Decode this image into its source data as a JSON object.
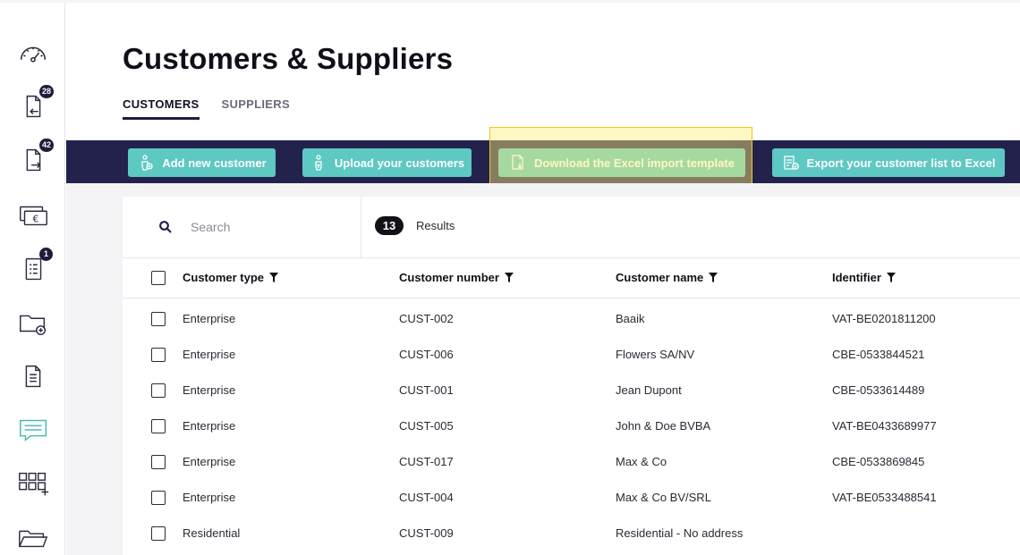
{
  "sidebar": {
    "items": [
      {
        "name": "dashboard",
        "icon": "speedometer-icon",
        "badge": ""
      },
      {
        "name": "incoming-documents",
        "icon": "document-in-icon",
        "badge": "28"
      },
      {
        "name": "outgoing-documents",
        "icon": "document-out-icon",
        "badge": "42"
      },
      {
        "name": "payments",
        "icon": "euro-cards-icon",
        "badge": ""
      },
      {
        "name": "tasks",
        "icon": "checklist-icon",
        "badge": "1"
      },
      {
        "name": "add-folder",
        "icon": "folder-plus-icon",
        "badge": ""
      },
      {
        "name": "reports",
        "icon": "document-lines-icon",
        "badge": ""
      },
      {
        "name": "messages",
        "icon": "message-icon",
        "badge": ""
      },
      {
        "name": "apps",
        "icon": "grid-plus-icon",
        "badge": ""
      },
      {
        "name": "documents",
        "icon": "folder-open-icon",
        "badge": ""
      }
    ]
  },
  "page": {
    "title": "Customers & Suppliers",
    "tabs": [
      {
        "label": "CUSTOMERS",
        "active": true
      },
      {
        "label": "SUPPLIERS",
        "active": false
      }
    ]
  },
  "toolbar": {
    "add_label": "Add new customer",
    "upload_label": "Upload your customers",
    "download_label": "Download the Excel import template",
    "export_label": "Export your customer list to Excel"
  },
  "search": {
    "placeholder": "Search",
    "value": ""
  },
  "results": {
    "count": "13",
    "label": "Results"
  },
  "table": {
    "columns": [
      "Customer type",
      "Customer number",
      "Customer name",
      "Identifier"
    ],
    "rows": [
      [
        "Enterprise",
        "CUST-002",
        "Baaik",
        "VAT-BE0201811200"
      ],
      [
        "Enterprise",
        "CUST-006",
        "Flowers SA/NV",
        "CBE-0533844521"
      ],
      [
        "Enterprise",
        "CUST-001",
        "Jean Dupont",
        "CBE-0533614489"
      ],
      [
        "Enterprise",
        "CUST-005",
        "John & Doe BVBA",
        "VAT-BE0433689977"
      ],
      [
        "Enterprise",
        "CUST-017",
        "Max & Co",
        "CBE-0533869845"
      ],
      [
        "Enterprise",
        "CUST-004",
        "Max & Co BV/SRL",
        "VAT-BE0533488541"
      ],
      [
        "Residential",
        "CUST-009",
        "Residential - No address",
        ""
      ]
    ]
  },
  "colors": {
    "toolbar_bg": "#23224d",
    "button_bg": "#5ec8c2",
    "accent_teal": "#4fbcb6",
    "dark": "#1d1d3b"
  }
}
